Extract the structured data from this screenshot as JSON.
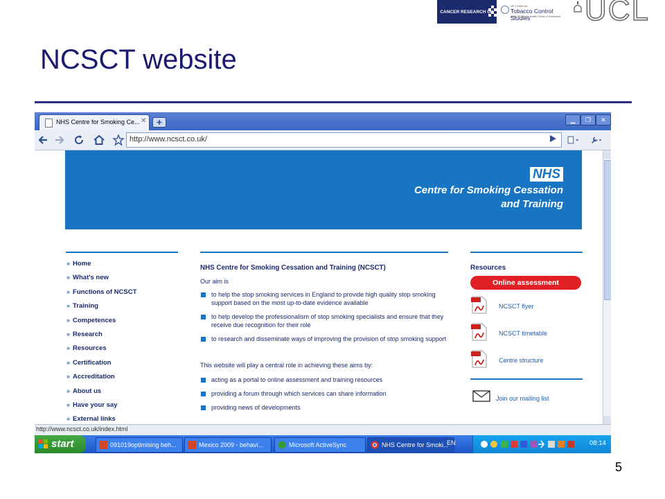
{
  "slide": {
    "title": "NCSCT website",
    "page_number": "5",
    "logos": {
      "cruk": "CANCER RESEARCH UK",
      "uktcs_line1": "UK Centre for",
      "uktcs_line2": "Tobacco Control Studies",
      "uktcs_line3": "A UKCRC Public Health Centre of Excellence",
      "ucl": "UCL"
    }
  },
  "browser": {
    "tab_title": "NHS Centre for Smoking Ce...",
    "url": "http://www.ncsct.co.uk/",
    "status": "http://www.ncsct.co.uk/index.html"
  },
  "website": {
    "nhs_logo": "NHS",
    "banner_title_line1": "Centre for Smoking Cessation",
    "banner_title_line2": "and Training",
    "nav": [
      "Home",
      "What's new",
      "Functions of NCSCT",
      "Training",
      "Competences",
      "Research",
      "Resources",
      "Certification",
      "Accreditation",
      "About us",
      "Have your say",
      "External links"
    ],
    "main": {
      "heading": "NHS Centre for Smoking Cessation and Training (NCSCT)",
      "aim_intro": "Our aim is",
      "aims": [
        "to help the stop smoking services in England to provide high quality stop smoking support based on the most up-to-date evidence available",
        "to help develop the professionalism of stop smoking specialists and ensure that they receive due recognition for their role",
        "to research and disseminate ways of improving the provision of stop smoking support"
      ],
      "role_intro": "This website will play a central role in achieving these aims by:",
      "roles": [
        "acting as a portal to online assessment and training resources",
        "providing a forum through which services can share information",
        "providing news of developments"
      ]
    },
    "sidebar": {
      "heading": "Resources",
      "online_button": "Online assessment",
      "resources": [
        "NCSCT flyer",
        "NCSCT timetable",
        "Centre structure"
      ],
      "mailing": "Join our mailing list"
    }
  },
  "taskbar": {
    "start": "start",
    "items": [
      "091019optimising beh...",
      "Mexico 2009 - behavi...",
      "Microsoft ActiveSync",
      "NHS Centre for Smoki..."
    ],
    "lang": "EN",
    "clock": "08:14"
  },
  "colors": {
    "nhs_blue": "#1775c4",
    "title_navy": "#1a1a6e",
    "button_red": "#e01f26"
  }
}
